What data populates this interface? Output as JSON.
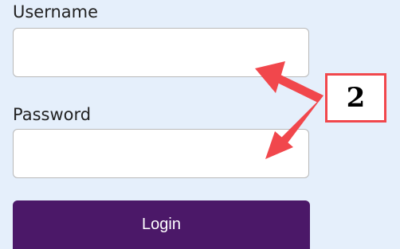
{
  "form": {
    "username_label": "Username",
    "username_value": "",
    "password_label": "Password",
    "password_value": "",
    "login_label": "Login"
  },
  "annotation": {
    "step_number": "2",
    "arrow_color": "#f1474c"
  },
  "colors": {
    "background": "#e5effb",
    "button": "#4b1868",
    "button_text": "#ffffff"
  }
}
